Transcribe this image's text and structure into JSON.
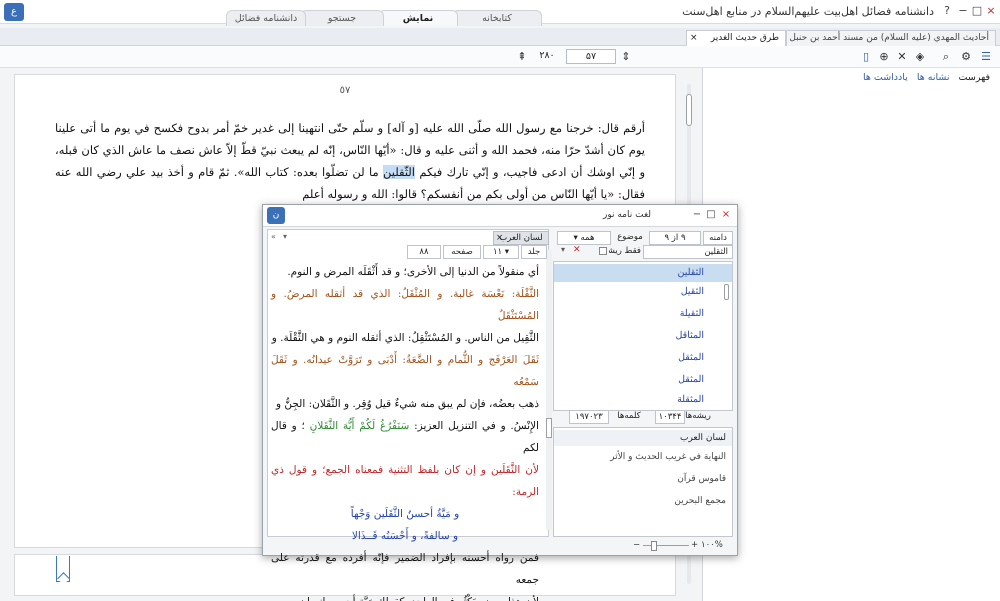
{
  "window": {
    "title": "دانشنامه فضائل اهل‌بیت علیهم‌السلام در منابع اهل‌سنت",
    "controls": [
      "?",
      "−",
      "□",
      "×"
    ]
  },
  "main_tabs": [
    {
      "label": "کتابخانه"
    },
    {
      "label": "نمایش",
      "active": true
    },
    {
      "label": "جستجو"
    },
    {
      "label": "دانشنامه فضائل"
    }
  ],
  "doc_tabs": [
    {
      "label": "أحاديث المهدي (عليه السلام) من مسند أحمد بن حنبل"
    },
    {
      "label": "طرق حديث الغدير",
      "active": true
    }
  ],
  "toolbar": {
    "current_page": "۵۷",
    "total_pages": "۲۸۰"
  },
  "side_panel": {
    "tabs": [
      {
        "label": "فهرست",
        "active": true
      },
      {
        "label": "نشانه ها"
      },
      {
        "label": "یادداشت ها"
      }
    ]
  },
  "document": {
    "page_number": "٥٧",
    "text_before": "أرقم قال: خرجنا مع رسول الله صلّى الله عليه [و آله] و سلّم حتّى انتهينا إلى غدير خمّ أمر بدوح فكسح في يوم ما أتى علينا يوم كان أشدّ حرّا منه، فحمد الله و أثنى عليه و قال: «أيّها النّاس، إنّه لم يبعث نبيّ قطّ إلاّ عاش نصف ما عاش الذي كان قبله، و إنّي اوشك أن ادعى فاجيب، و إنّي تارك فيكم ",
    "highlight": "الثّقلين",
    "text_after": " ما لن تضلّوا بعده: كتاب الله». ثمّ قام و أخذ بيد علي رضي الله عنه فقال: «يا أيّها النّاس من أولى بكم من أنفسكم؟ قالوا: الله و رسوله أعلم"
  },
  "dialog": {
    "title": "لغت نامه نور",
    "source_tab": "لسان العرب",
    "fields": {
      "volume_label": "جلد",
      "volume_value": "۱۱",
      "page_label": "صفحه",
      "page_value": "۸۸",
      "count_a": "۹ از ۹",
      "domain_label": "دامنه",
      "topic_label": "موضوع",
      "topic_value": "همه",
      "search_value": "الثقلين",
      "root_only_label": "فقط ریشه",
      "roots_label": "ریشه‌ها",
      "roots_value": "۱۰۳۴۴",
      "words_label": "کلمه‌ها",
      "words_value": "۱۹۷۰۲۳"
    },
    "zoom": "۱۰۰%",
    "text_lines": [
      "أي منقولاً من الدنيا إلى الأخرى؛ و قد أَثْقَلَه المرض و النوم.",
      "الثَّقْلَة: نَعْسَة غالبة. و المُثْقَلُ: الذي قد أثقله المرضُ. و المُسْتَثْقَلُ",
      "الثَّقِيل من الناس. و المُسْتَثْقِلُ: الذي أثقله النوم و هي الثَّقْلَة. و",
      "ثَقَلَ العَرْفَج و الثُّمام و الضَّعَةُ: أَدْبَى و تَرَوَّتْ عيدانُه. و ثَقَلَ سَمْعُه",
      "ذهب بعضُه، فإن لم يبق منه شيءٌ قيل وُقِر. و الثَّقَلان: الجِنُّ و",
      "الإِنْسُ. و في التنزيل العزيز:",
      "سَنَفْرُغُ لَكُمْ أَيُّهَ الثَّقَلانِ",
      "؛ و قال لكم",
      "لأن الثَّقَلَين و إن كان بلفظ التثنية فمعناه الجمع؛ و قول ذي الرمة:",
      "و مَيَّةُ أحسنُ الثَّقَلَين وَجْهاً",
      "و سالفةً، و أَحْسَنُه قَــذَالا",
      "فمن رواه أحسنه بإفراد الضمير فإنّه أفرده مع قدرته على جمعه",
      "لأن هذا موضع يَكْثُر فيه الواحد، كقولك مَيَّة أحسن إنسان"
    ],
    "words": [
      "الثقلين",
      "الثقيل",
      "الثقيلة",
      "المثاقل",
      "المثقل",
      "المثقل",
      "المثقلة"
    ],
    "sources": [
      "لسان العرب",
      "النهاية في غريب الحديث و الأثر",
      "قاموس قرآن",
      "مجمع البحرين"
    ]
  }
}
